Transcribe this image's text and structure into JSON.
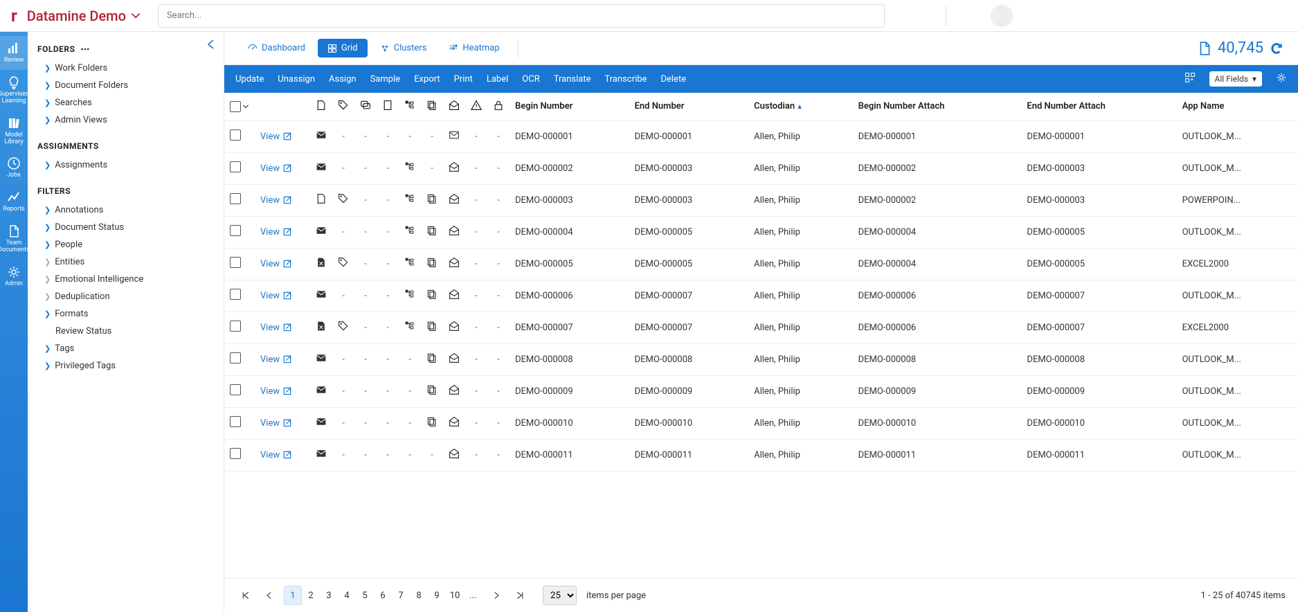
{
  "header": {
    "project_name": "Datamine Demo",
    "search_placeholder": "Search..."
  },
  "sidenav": [
    {
      "label": "Review",
      "active": true
    },
    {
      "label": "Supervised Learning"
    },
    {
      "label": "Model Library"
    },
    {
      "label": "Jobs"
    },
    {
      "label": "Reports"
    },
    {
      "label": "Team Documents"
    },
    {
      "label": "Admin"
    }
  ],
  "leftpanel": {
    "folders_title": "FOLDERS",
    "folders": [
      "Work Folders",
      "Document Folders",
      "Searches",
      "Admin Views"
    ],
    "assignments_title": "ASSIGNMENTS",
    "assignments": [
      "Assignments"
    ],
    "filters_title": "FILTERS",
    "filters": [
      {
        "label": "Annotations",
        "muted": false
      },
      {
        "label": "Document Status",
        "muted": false
      },
      {
        "label": "People",
        "muted": false
      },
      {
        "label": "Entities",
        "muted": true
      },
      {
        "label": "Emotional Intelligence",
        "muted": true
      },
      {
        "label": "Deduplication",
        "muted": true
      },
      {
        "label": "Formats",
        "muted": false
      },
      {
        "label": "Review Status",
        "noexp": true
      },
      {
        "label": "Tags",
        "muted": false
      },
      {
        "label": "Privileged Tags",
        "muted": false
      }
    ]
  },
  "viewtabs": {
    "dashboard": "Dashboard",
    "grid": "Grid",
    "clusters": "Clusters",
    "heatmap": "Heatmap",
    "doc_count": "40,745"
  },
  "actions": [
    "Update",
    "Unassign",
    "Assign",
    "Sample",
    "Export",
    "Print",
    "Label",
    "OCR",
    "Translate",
    "Transcribe",
    "Delete"
  ],
  "field_selector": "All Fields",
  "columns": {
    "begin": "Begin Number",
    "end": "End Number",
    "custodian": "Custodian",
    "begin_attach": "Begin Number Attach",
    "end_attach": "End Number Attach",
    "app": "App Name"
  },
  "view_label": "View",
  "rows": [
    {
      "type": "mail",
      "tag": false,
      "tree": false,
      "dup": false,
      "read": true,
      "begin": "DEMO-000001",
      "end": "DEMO-000001",
      "cust": "Allen, Philip",
      "ba": "DEMO-000001",
      "ea": "DEMO-000001",
      "app": "OUTLOOK_M..."
    },
    {
      "type": "mail",
      "tag": false,
      "tree": true,
      "dup": false,
      "read": false,
      "begin": "DEMO-000002",
      "end": "DEMO-000003",
      "cust": "Allen, Philip",
      "ba": "DEMO-000002",
      "ea": "DEMO-000003",
      "app": "OUTLOOK_M..."
    },
    {
      "type": "file",
      "tag": true,
      "tree": true,
      "dup": true,
      "read": false,
      "begin": "DEMO-000003",
      "end": "DEMO-000003",
      "cust": "Allen, Philip",
      "ba": "DEMO-000002",
      "ea": "DEMO-000003",
      "app": "POWERPOIN..."
    },
    {
      "type": "mail",
      "tag": false,
      "tree": true,
      "dup": true,
      "read": false,
      "begin": "DEMO-000004",
      "end": "DEMO-000005",
      "cust": "Allen, Philip",
      "ba": "DEMO-000004",
      "ea": "DEMO-000005",
      "app": "OUTLOOK_M..."
    },
    {
      "type": "file2",
      "tag": true,
      "tree": true,
      "dup": true,
      "read": false,
      "begin": "DEMO-000005",
      "end": "DEMO-000005",
      "cust": "Allen, Philip",
      "ba": "DEMO-000004",
      "ea": "DEMO-000005",
      "app": "EXCEL2000"
    },
    {
      "type": "mail",
      "tag": false,
      "tree": true,
      "dup": true,
      "read": false,
      "begin": "DEMO-000006",
      "end": "DEMO-000007",
      "cust": "Allen, Philip",
      "ba": "DEMO-000006",
      "ea": "DEMO-000007",
      "app": "OUTLOOK_M..."
    },
    {
      "type": "file2",
      "tag": true,
      "tree": true,
      "dup": true,
      "read": false,
      "begin": "DEMO-000007",
      "end": "DEMO-000007",
      "cust": "Allen, Philip",
      "ba": "DEMO-000006",
      "ea": "DEMO-000007",
      "app": "EXCEL2000"
    },
    {
      "type": "mail",
      "tag": false,
      "tree": false,
      "dup": true,
      "read": false,
      "begin": "DEMO-000008",
      "end": "DEMO-000008",
      "cust": "Allen, Philip",
      "ba": "DEMO-000008",
      "ea": "DEMO-000008",
      "app": "OUTLOOK_M..."
    },
    {
      "type": "mail",
      "tag": false,
      "tree": false,
      "dup": true,
      "read": false,
      "begin": "DEMO-000009",
      "end": "DEMO-000009",
      "cust": "Allen, Philip",
      "ba": "DEMO-000009",
      "ea": "DEMO-000009",
      "app": "OUTLOOK_M..."
    },
    {
      "type": "mail",
      "tag": false,
      "tree": false,
      "dup": true,
      "read": false,
      "begin": "DEMO-000010",
      "end": "DEMO-000010",
      "cust": "Allen, Philip",
      "ba": "DEMO-000010",
      "ea": "DEMO-000010",
      "app": "OUTLOOK_M..."
    },
    {
      "type": "mail",
      "tag": false,
      "tree": false,
      "dup": false,
      "read": false,
      "begin": "DEMO-000011",
      "end": "DEMO-000011",
      "cust": "Allen, Philip",
      "ba": "DEMO-000011",
      "ea": "DEMO-000011",
      "app": "OUTLOOK_M..."
    }
  ],
  "pager": {
    "pages": [
      "1",
      "2",
      "3",
      "4",
      "5",
      "6",
      "7",
      "8",
      "9",
      "10",
      "..."
    ],
    "page_size": "25",
    "per_page_label": "items per page",
    "summary": "1 - 25 of 40745 items"
  }
}
